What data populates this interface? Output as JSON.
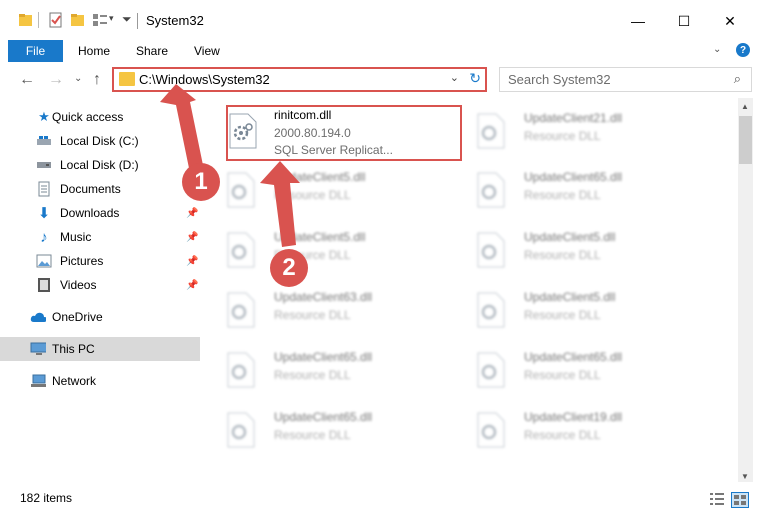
{
  "window": {
    "title": "System32",
    "minimize": "—",
    "maximize": "☐",
    "close": "✕"
  },
  "ribbon": {
    "tabs": [
      "File",
      "Home",
      "Share",
      "View"
    ]
  },
  "nav": {
    "address": "C:\\Windows\\System32",
    "search_placeholder": "Search System32"
  },
  "sidebar": {
    "items": [
      {
        "label": "Quick access",
        "icon": "star-icon",
        "pinned": false
      },
      {
        "label": "Local Disk (C:)",
        "icon": "drive-icon",
        "pinned": false
      },
      {
        "label": "Local Disk (D:)",
        "icon": "drive-icon",
        "pinned": false
      },
      {
        "label": "Documents",
        "icon": "documents-icon",
        "pinned": false
      },
      {
        "label": "Downloads",
        "icon": "download-icon",
        "pinned": true
      },
      {
        "label": "Music",
        "icon": "music-icon",
        "pinned": true
      },
      {
        "label": "Pictures",
        "icon": "pictures-icon",
        "pinned": true
      },
      {
        "label": "Videos",
        "icon": "videos-icon",
        "pinned": true
      },
      {
        "label": "OneDrive",
        "icon": "cloud-icon",
        "pinned": false
      },
      {
        "label": "This PC",
        "icon": "computer-icon",
        "pinned": false,
        "selected": true
      },
      {
        "label": "Network",
        "icon": "network-icon",
        "pinned": false
      }
    ]
  },
  "files": {
    "highlighted": {
      "name": "rinitcom.dll",
      "version": "2000.80.194.0",
      "description": "SQL Server Replicat..."
    },
    "others": [
      {
        "name": "UpdateClient21.dll",
        "description": "Resource DLL"
      },
      {
        "name": "UpdateClient5.dll",
        "description": "Resource DLL"
      },
      {
        "name": "UpdateClient65.dll",
        "description": "Resource DLL"
      },
      {
        "name": "UpdateClient5.dll",
        "description": "Resource DLL"
      },
      {
        "name": "UpdateClient5.dll",
        "description": "Resource DLL"
      },
      {
        "name": "UpdateClient63.dll",
        "description": "Resource DLL"
      },
      {
        "name": "UpdateClient5.dll",
        "description": "Resource DLL"
      },
      {
        "name": "UpdateClient65.dll",
        "description": "Resource DLL"
      },
      {
        "name": "UpdateClient65.dll",
        "description": "Resource DLL"
      },
      {
        "name": "UpdateClient65.dll",
        "description": "Resource DLL"
      },
      {
        "name": "UpdateClient19.dll",
        "description": "Resource DLL"
      }
    ]
  },
  "status": {
    "item_count": "182 items"
  },
  "annotations": {
    "step1": "1",
    "step2": "2",
    "color": "#d9534f"
  },
  "colors": {
    "accent": "#1979ca",
    "highlight_border": "#d9534f",
    "selected_bg": "#d9d9d9"
  }
}
